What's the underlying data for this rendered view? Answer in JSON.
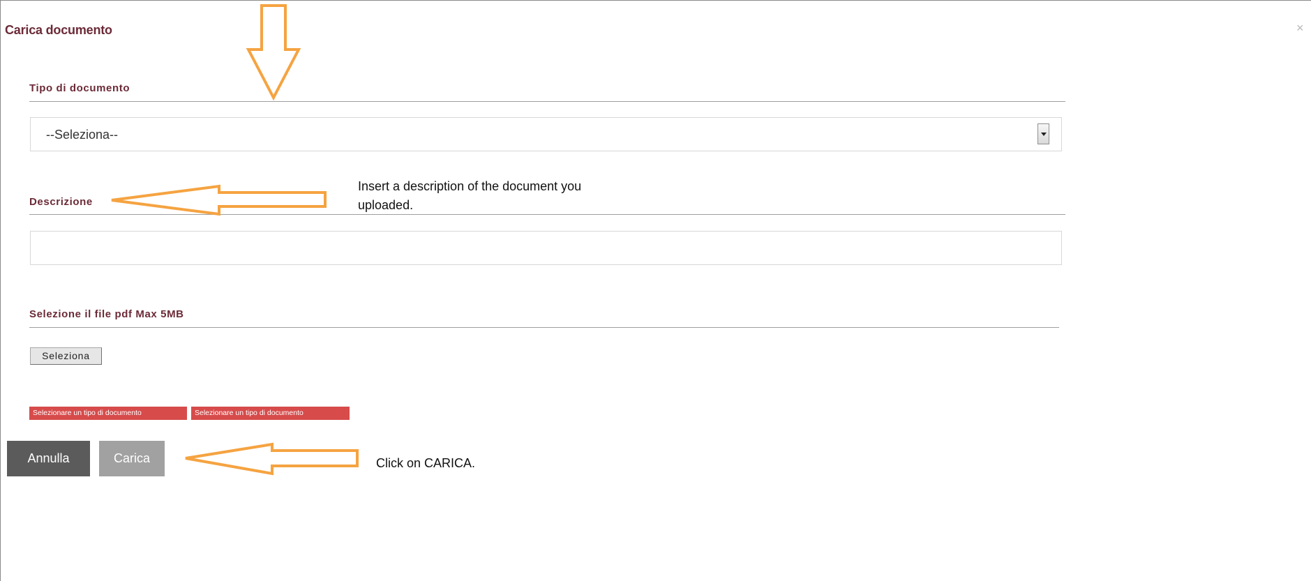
{
  "modal": {
    "title": "Carica documento",
    "close_glyph": "×"
  },
  "tipo": {
    "label": "Tipo di documento",
    "selected": "--Seleziona--"
  },
  "descrizione": {
    "label": "Descrizione",
    "value": ""
  },
  "file": {
    "label": "Selezione il file pdf Max 5MB",
    "button": "Seleziona"
  },
  "errors": [
    "Selezionare un tipo di documento",
    "Selezionare un tipo di documento"
  ],
  "buttons": {
    "cancel": "Annulla",
    "upload": "Carica"
  },
  "annotations": {
    "description_note": "Insert a description of the document you uploaded.",
    "upload_note": "Click on CARICA.",
    "arrow_color": "#f5a341"
  }
}
